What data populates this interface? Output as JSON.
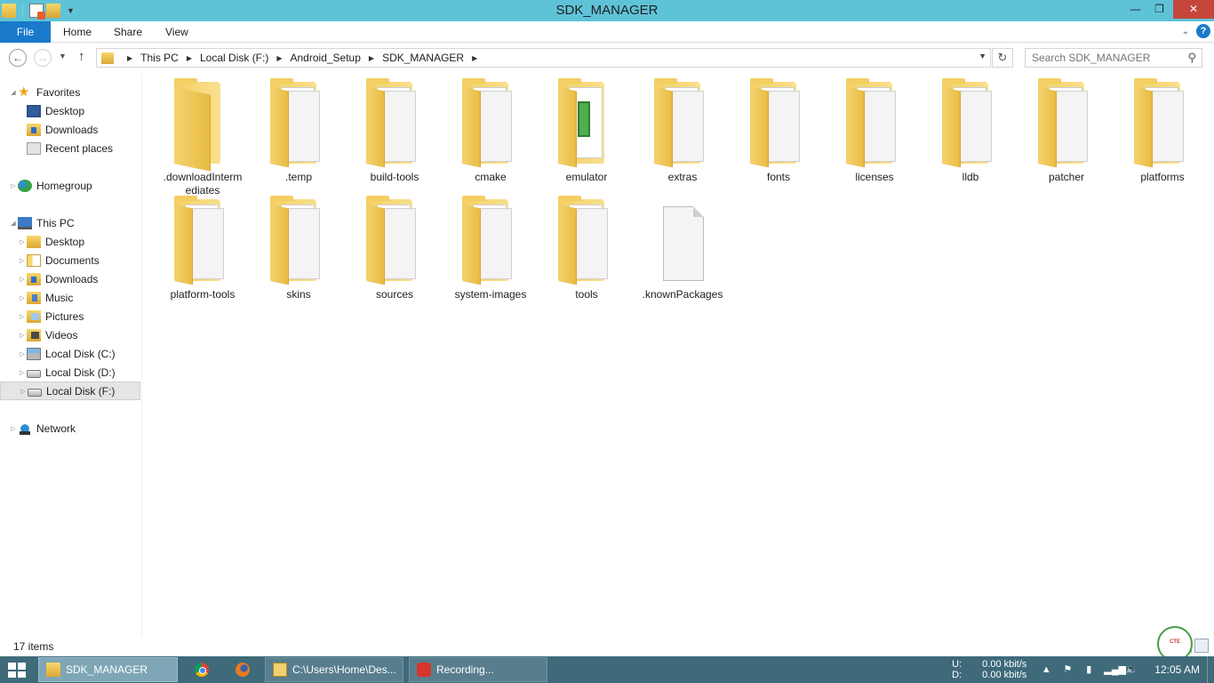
{
  "window": {
    "title": "SDK_MANAGER",
    "minimize": "—",
    "restore": "❐",
    "close": "✕"
  },
  "ribbon": {
    "file": "File",
    "home": "Home",
    "share": "Share",
    "view": "View"
  },
  "address": {
    "crumbs": [
      "This PC",
      "Local Disk (F:)",
      "Android_Setup",
      "SDK_MANAGER"
    ],
    "search_placeholder": "Search SDK_MANAGER"
  },
  "nav": {
    "favorites": "Favorites",
    "fav_desktop": "Desktop",
    "fav_downloads": "Downloads",
    "fav_recent": "Recent places",
    "homegroup": "Homegroup",
    "thispc": "This PC",
    "pc_desktop": "Desktop",
    "pc_documents": "Documents",
    "pc_downloads": "Downloads",
    "pc_music": "Music",
    "pc_pictures": "Pictures",
    "pc_videos": "Videos",
    "disk_c": "Local Disk (C:)",
    "disk_d": "Local Disk (D:)",
    "disk_f": "Local Disk (F:)",
    "network": "Network"
  },
  "files": [
    {
      "name": ".downloadIntermediates"
    },
    {
      "name": ".temp"
    },
    {
      "name": "build-tools"
    },
    {
      "name": "cmake"
    },
    {
      "name": "emulator"
    },
    {
      "name": "extras"
    },
    {
      "name": "fonts"
    },
    {
      "name": "licenses"
    },
    {
      "name": "lldb"
    },
    {
      "name": "patcher"
    },
    {
      "name": "platforms"
    },
    {
      "name": "platform-tools"
    },
    {
      "name": "skins"
    },
    {
      "name": "sources"
    },
    {
      "name": "system-images"
    },
    {
      "name": "tools"
    },
    {
      "name": ".knownPackages"
    }
  ],
  "status": {
    "count": "17 items"
  },
  "taskbar": {
    "explorer": "SDK_MANAGER",
    "cmd": "C:\\Users\\Home\\Des...",
    "recording": "Recording...",
    "up_label": "U:",
    "down_label": "D:",
    "up_rate": "0.00 kbit/s",
    "down_rate": "0.00 kbit/s",
    "clock": "12:05 AM"
  },
  "colors": {
    "titlebar": "#5fc3d8",
    "file_tab": "#1979ca",
    "taskbar": "#3e6a7a",
    "close_button": "#c7463b"
  }
}
